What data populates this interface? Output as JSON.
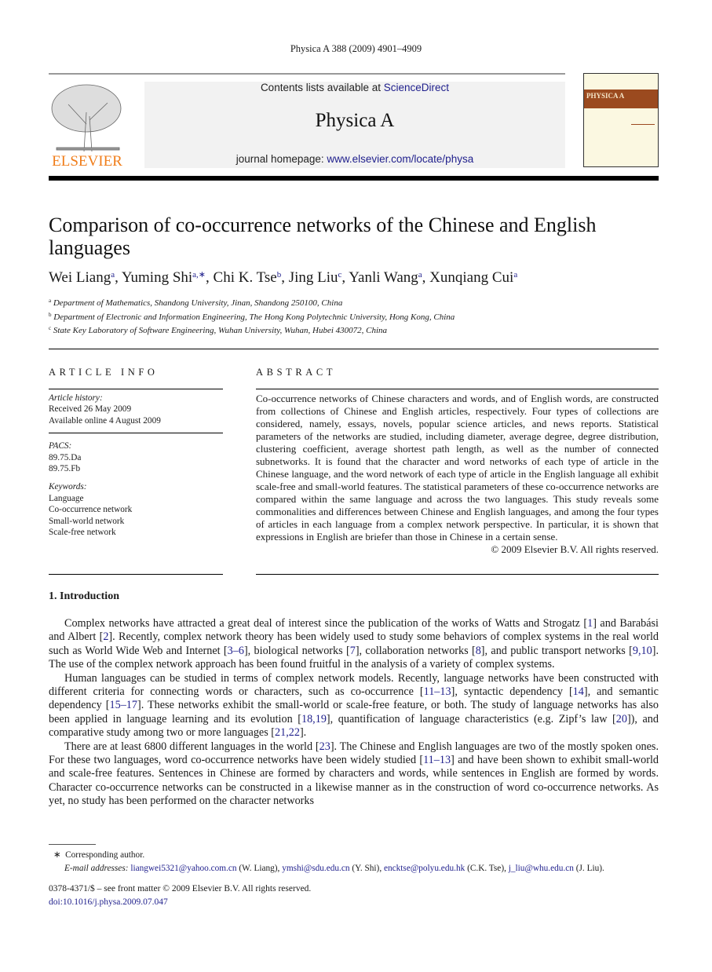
{
  "running_head": "Physica A 388 (2009) 4901–4909",
  "masthead": {
    "contents_prefix": "Contents lists available at ",
    "contents_link": "ScienceDirect",
    "journal": "Physica A",
    "homepage_prefix": "journal homepage: ",
    "homepage_link": "www.elsevier.com/locate/physa",
    "publisher_logo": "ELSEVIER",
    "cover_title": "PHYSICA A",
    "colors": {
      "elsevier_orange": "#f07d1a",
      "link_blue": "#1f1f8c",
      "cover_brown": "#9b4a1f"
    }
  },
  "title": "Comparison of co-occurrence networks of the Chinese and English languages",
  "authors": [
    {
      "name": "Wei Liang",
      "sup": "a"
    },
    {
      "name": "Yuming Shi",
      "sup": "a,∗"
    },
    {
      "name": "Chi K. Tse",
      "sup": "b"
    },
    {
      "name": "Jing Liu",
      "sup": "c"
    },
    {
      "name": "Yanli Wang",
      "sup": "a"
    },
    {
      "name": "Xunqiang Cui",
      "sup": "a"
    }
  ],
  "affiliations": [
    {
      "sup": "a",
      "text": "Department of Mathematics, Shandong University, Jinan, Shandong 250100, China"
    },
    {
      "sup": "b",
      "text": "Department of Electronic and Information Engineering, The Hong Kong Polytechnic University, Hong Kong, China"
    },
    {
      "sup": "c",
      "text": "State Key Laboratory of Software Engineering, Wuhan University, Wuhan, Hubei 430072, China"
    }
  ],
  "article_info": {
    "heading": "ARTICLE INFO",
    "history_label": "Article history:",
    "received": "Received 26 May 2009",
    "online": "Available online 4 August 2009",
    "pacs_label": "PACS:",
    "pacs": [
      "89.75.Da",
      "89.75.Fb"
    ],
    "keywords_label": "Keywords:",
    "keywords": [
      "Language",
      "Co-occurrence network",
      "Small-world network",
      "Scale-free network"
    ]
  },
  "abstract": {
    "heading": "ABSTRACT",
    "text": "Co-occurrence networks of Chinese characters and words, and of English words, are constructed from collections of Chinese and English articles, respectively. Four types of collections are considered, namely, essays, novels, popular science articles, and news reports. Statistical parameters of the networks are studied, including diameter, average degree, degree distribution, clustering coefficient, average shortest path length, as well as the number of connected subnetworks. It is found that the character and word networks of each type of article in the Chinese language, and the word network of each type of article in the English language all exhibit scale-free and small-world features. The statistical parameters of these co-occurrence networks are compared within the same language and across the two languages. This study reveals some commonalities and differences between Chinese and English languages, and among the four types of articles in each language from a complex network perspective. In particular, it is shown that expressions in English are briefer than those in Chinese in a certain sense.",
    "copyright": "© 2009 Elsevier B.V. All rights reserved."
  },
  "intro": {
    "heading": "1.  Introduction",
    "paragraphs": [
      "Complex networks have attracted a great deal of interest since the publication of the works of Watts and Strogatz [1] and Barabási and Albert [2]. Recently, complex network theory has been widely used to study some behaviors of complex systems in the real world such as World Wide Web and Internet [3–6], biological networks [7], collaboration networks [8], and public transport networks [9,10]. The use of the complex network approach has been found fruitful in the analysis of a variety of complex systems.",
      "Human languages can be studied in terms of complex network models. Recently, language networks have been constructed with different criteria for connecting words or characters, such as co-occurrence [11–13], syntactic dependency [14], and semantic dependency [15–17]. These networks exhibit the small-world or scale-free feature, or both. The study of language networks has also been applied in language learning and its evolution [18,19], quantification of language characteristics (e.g. Zipf’s law [20]), and comparative study among two or more languages [21,22].",
      "There are at least 6800 different languages in the world [23]. The Chinese and English languages are two of the mostly spoken ones. For these two languages, word co-occurrence networks have been widely studied [11–13] and have been shown to exhibit small-world and scale-free features. Sentences in Chinese are formed by characters and words, while sentences in English are formed by words. Character co-occurrence networks can be constructed in a likewise manner as in the construction of word co-occurrence networks. As yet, no study has been performed on the character networks"
    ]
  },
  "footnote": {
    "mark": "∗",
    "corresponding": "Corresponding author.",
    "email_label": "E-mail addresses:",
    "emails": [
      {
        "addr": "liangwei5321@yahoo.com.cn",
        "who": " (W. Liang), "
      },
      {
        "addr": "ymshi@sdu.edu.cn",
        "who": " (Y. Shi), "
      },
      {
        "addr": "encktse@polyu.edu.hk",
        "who": " (C.K. Tse), "
      },
      {
        "addr": "j_liu@whu.edu.cn",
        "who": " (J. Liu)."
      }
    ]
  },
  "front_matter": "0378-4371/$ – see front matter © 2009 Elsevier B.V. All rights reserved.",
  "doi": "doi:10.1016/j.physa.2009.07.047"
}
